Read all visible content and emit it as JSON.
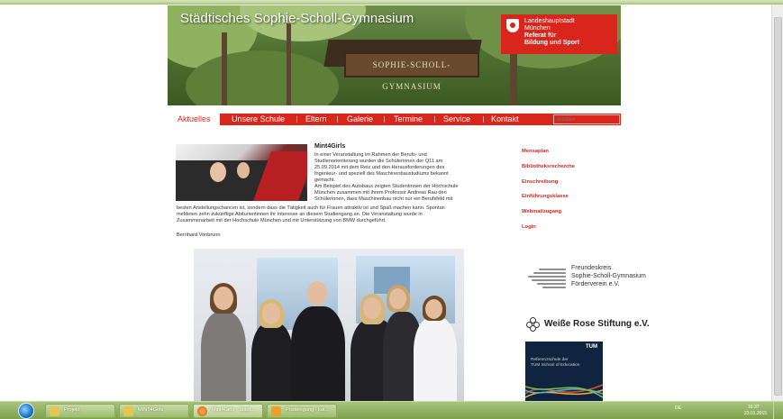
{
  "site": {
    "title": "Städtisches Sophie-Scholl-Gymnasium",
    "sign_text": "SOPHIE-SCHOLL-GYMNASIUM",
    "logo": {
      "line1": "Landeshauptstadt",
      "line2": "München",
      "line3": "Referat für",
      "line4": "Bildung und Sport"
    }
  },
  "nav": {
    "items": [
      "Aktuelles",
      "Unsere Schule",
      "Eltern",
      "Galerie",
      "Termine",
      "Service",
      "Kontakt"
    ],
    "search_placeholder": "Suchen"
  },
  "article": {
    "title": "Mint4Girls",
    "lines": [
      "In einer Veranstaltung im Rahmen der Berufs- und",
      "Studienorientierung wurden die Schülerinnen der Q11 am",
      "25.09.2014 mit dem Reiz und den Herausforderungen des",
      "Ingenieur- und speziell des Maschinenbaustudiums bekannt",
      "gemacht.",
      "Am Beispiel des Autobaus zeigten Studentinnen der Hochschule",
      "München zusammen mit ihrem Professor Andreas Rau den",
      "Schülerinnen, dass Maschinenbau nicht nur ein Berufsfeld mit"
    ],
    "full_lines": [
      "besten Anstellungschancen ist, sondern dass die Tätigkeit auch für Frauen attraktiv ist und Spaß machen kann. Spontan",
      "meldeten zehn zukünftige Abiturientinnen ihr Interesse an diesem Studiengang an. Die Veranstaltung wurde in",
      "Zusammenarbeit mit der Hochschule München und mit Unterstützung von BMW durchgeführt."
    ],
    "author": "Bernhard Vonbrunn"
  },
  "sidebar": {
    "links": [
      "Mensaplan",
      "Bibliotheksrecherche",
      "Einschreibung",
      "Einführungsklasse",
      "Webmailzugang",
      "Login"
    ],
    "freundeskreis": [
      "Freundeskreis",
      "Sophie-Scholl-Gymnasium",
      "Förderverein e.V."
    ],
    "weisse_rose": "Weiße Rose Stiftung e.V.",
    "tum": {
      "logo": "TUM",
      "lines": [
        "Referenzschule der",
        "TUM School of Education"
      ]
    }
  },
  "taskbar": {
    "buttons": [
      "Projekt",
      "MINT4Girls",
      "Mint4Girls - Städt...",
      "Posteingang - kat..."
    ],
    "tray": "DE",
    "time": "16:37",
    "date": "23.01.2015"
  },
  "colors": {
    "accent": "#d8261c",
    "taskbar": "#8fb35e"
  }
}
